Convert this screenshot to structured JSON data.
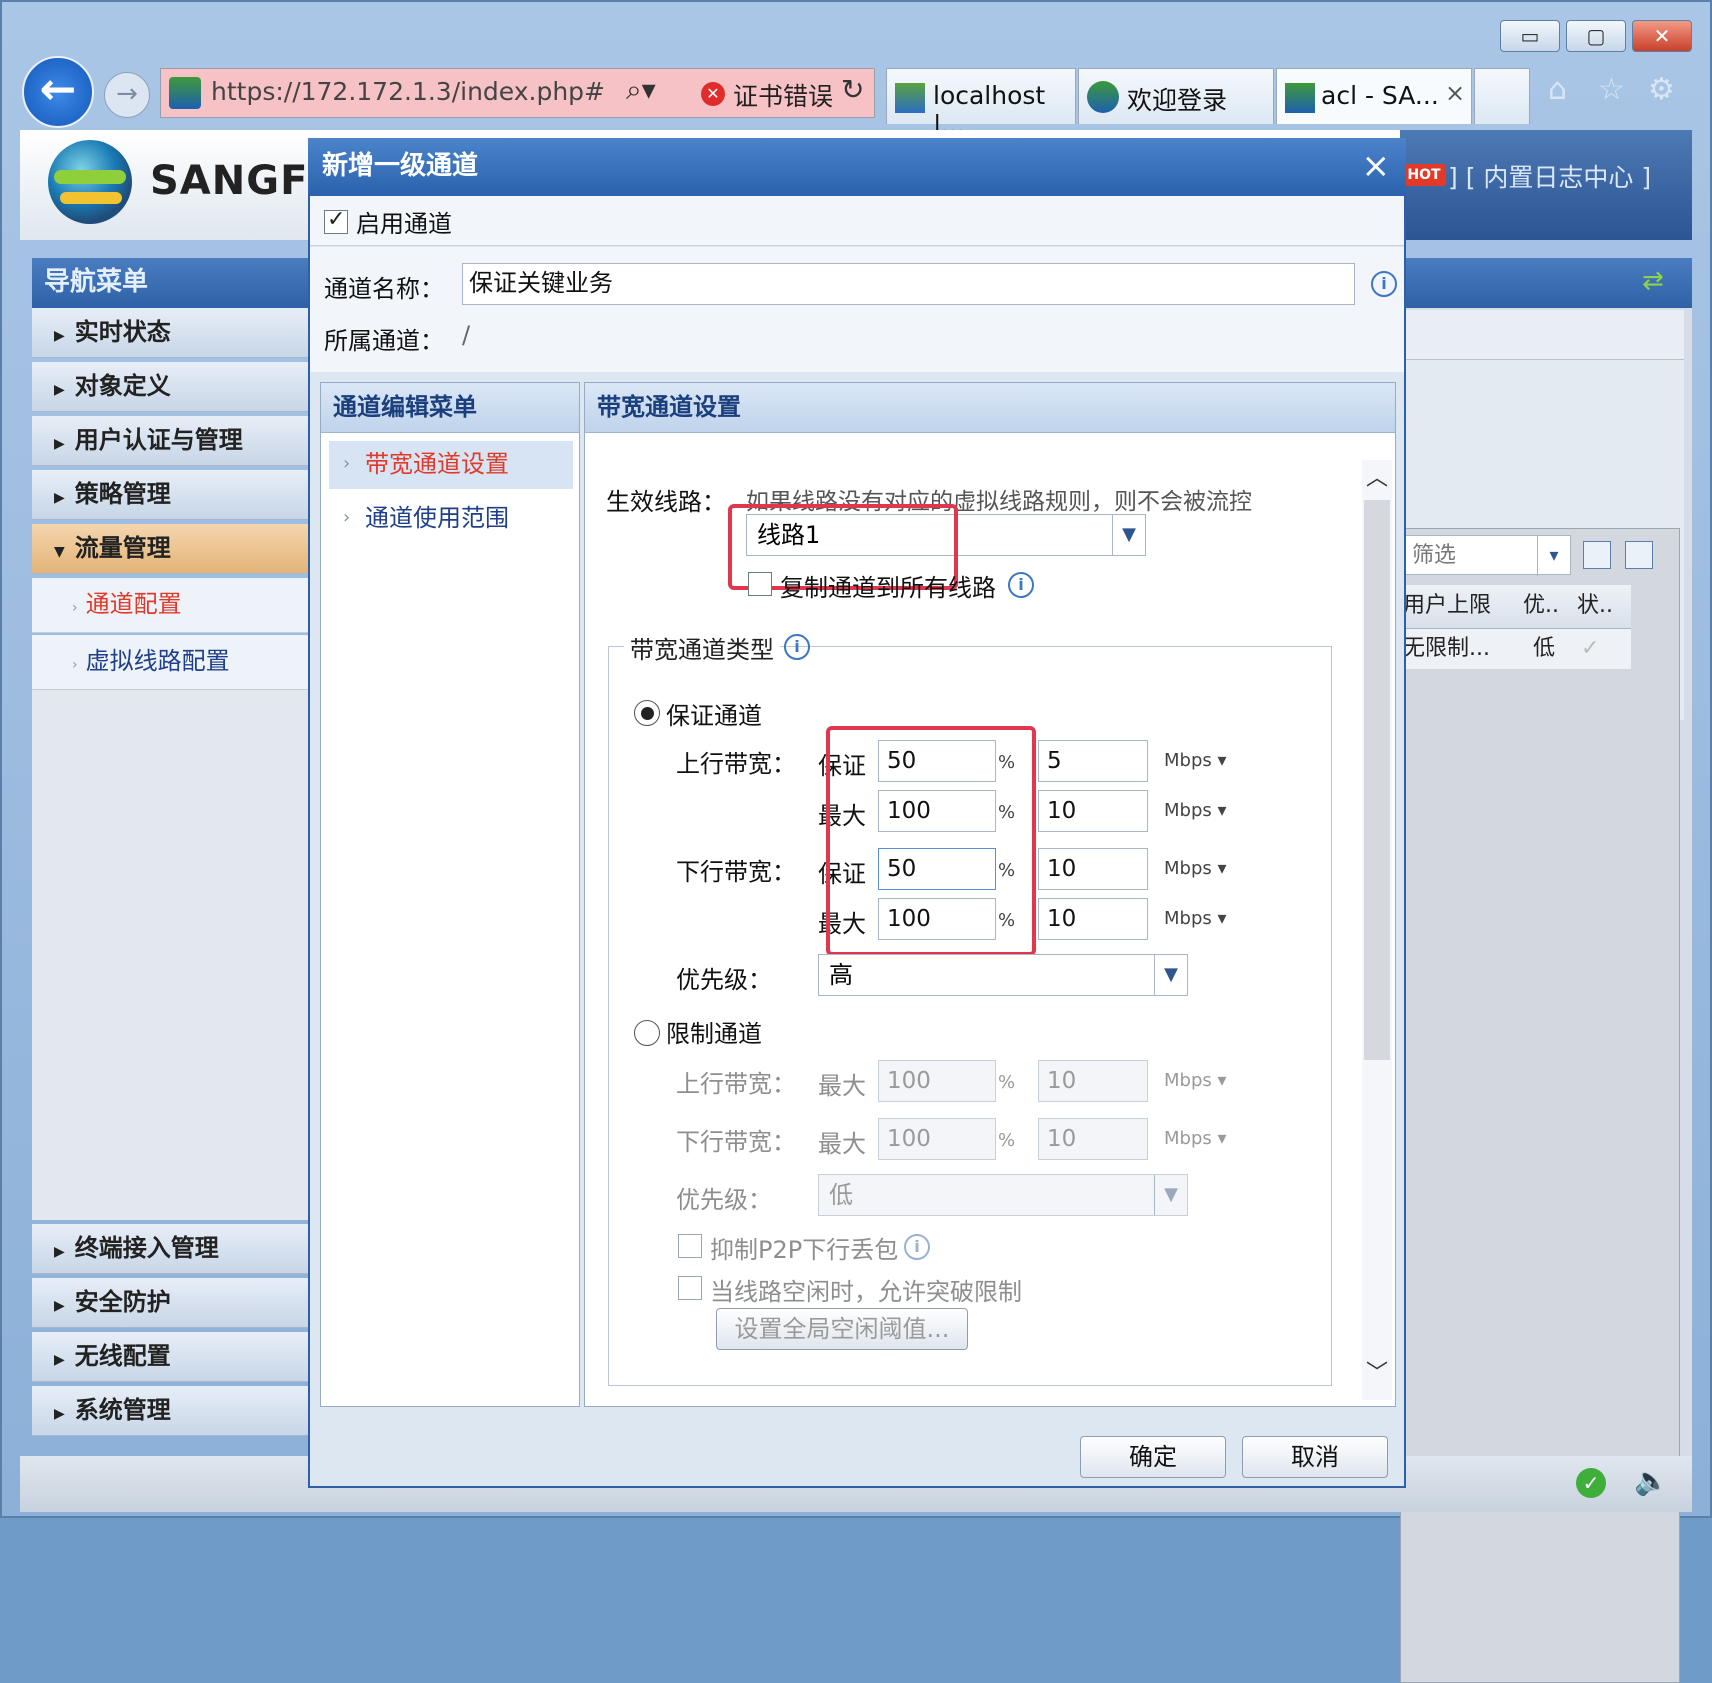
{
  "browser": {
    "url": "https://172.172.1.3/index.php#",
    "cert_error": "证书错误",
    "tabs": [
      {
        "label": "localhost |..."
      },
      {
        "label": "欢迎登录"
      },
      {
        "label": "acl - SA..."
      }
    ],
    "close_tab": "×"
  },
  "app": {
    "logo_text": "SANGFOR",
    "header_links": "] [ 内置日志中心 ]",
    "hot_badge": "HOT"
  },
  "sidebar": {
    "title": "导航菜单",
    "items": [
      {
        "label": "实时状态"
      },
      {
        "label": "对象定义"
      },
      {
        "label": "用户认证与管理"
      },
      {
        "label": "策略管理"
      },
      {
        "label": "流量管理"
      }
    ],
    "subitems": [
      {
        "label": "通道配置"
      },
      {
        "label": "虚拟线路配置"
      }
    ],
    "bottom_items": [
      {
        "label": "终端接入管理"
      },
      {
        "label": "安全防护"
      },
      {
        "label": "无线配置"
      },
      {
        "label": "系统管理"
      }
    ]
  },
  "background_table": {
    "filter_placeholder": "筛选",
    "headers": [
      "用户上限",
      "优..",
      "状.."
    ],
    "row": [
      "无限制...",
      "低",
      "✓"
    ]
  },
  "dialog": {
    "title": "新增一级通道",
    "close": "×",
    "enable_label": "启用通道",
    "name_label": "通道名称：",
    "name_value": "保证关键业务",
    "parent_label": "所属通道：",
    "parent_value": "/",
    "menu_title": "通道编辑菜单",
    "menu_items": [
      {
        "label": "带宽通道设置"
      },
      {
        "label": "通道使用范围"
      }
    ],
    "settings_title": "带宽通道设置",
    "line_label": "生效线路：",
    "line_hint": "如果线路没有对应的虚拟线路规则，则不会被流控",
    "line_value": "线路1",
    "copy_label": "复制通道到所有线路",
    "type_legend": "带宽通道类型",
    "guarantee": {
      "label": "保证通道",
      "up_label": "上行带宽：",
      "down_label": "下行带宽：",
      "guar_label": "保证",
      "max_label": "最大",
      "rows": [
        {
          "pct": "50",
          "val": "5",
          "unit": "Mbps"
        },
        {
          "pct": "100",
          "val": "10",
          "unit": "Mbps"
        },
        {
          "pct": "50",
          "val": "10",
          "unit": "Mbps"
        },
        {
          "pct": "100",
          "val": "10",
          "unit": "Mbps"
        }
      ],
      "pct_sign": "%",
      "priority_label": "优先级：",
      "priority_value": "高"
    },
    "limit": {
      "label": "限制通道",
      "up_label": "上行带宽：",
      "down_label": "下行带宽：",
      "max_label": "最大",
      "rows": [
        {
          "pct": "100",
          "val": "10",
          "unit": "Mbps"
        },
        {
          "pct": "100",
          "val": "10",
          "unit": "Mbps"
        }
      ],
      "priority_label": "优先级：",
      "priority_value": "低",
      "p2p_label": "抑制P2P下行丢包",
      "burst_label": "当线路空闲时，允许突破限制",
      "threshold_button": "设置全局空闲阈值..."
    },
    "ok_button": "确定",
    "cancel_button": "取消"
  },
  "colors": {
    "accent_red": "#e0374f",
    "dialog_blue": "#2a62ad",
    "active_menu_red": "#e23a2a"
  }
}
